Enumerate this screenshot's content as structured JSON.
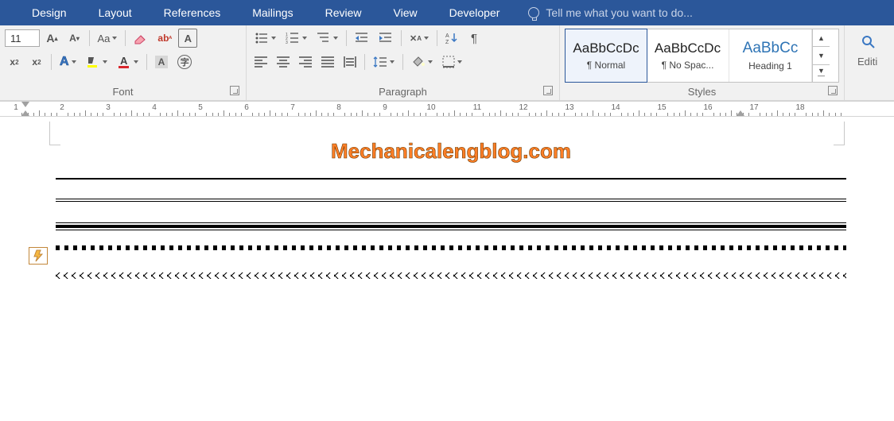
{
  "tabs": {
    "items": [
      "Design",
      "Layout",
      "References",
      "Mailings",
      "Review",
      "View",
      "Developer"
    ],
    "tellme": "Tell me what you want to do..."
  },
  "font": {
    "size": "11",
    "group_label": "Font"
  },
  "paragraph": {
    "group_label": "Paragraph"
  },
  "styles": {
    "group_label": "Styles",
    "items": [
      {
        "preview": "AaBbCcDc",
        "name": "¶ Normal"
      },
      {
        "preview": "AaBbCcDc",
        "name": "¶ No Spac..."
      },
      {
        "preview": "AaBbCc",
        "name": "Heading 1"
      }
    ]
  },
  "editing": {
    "group_label": "Editi"
  },
  "ruler": {
    "min": 1,
    "max": 18
  },
  "document": {
    "watermark": "Mechanicalengblog.com"
  }
}
